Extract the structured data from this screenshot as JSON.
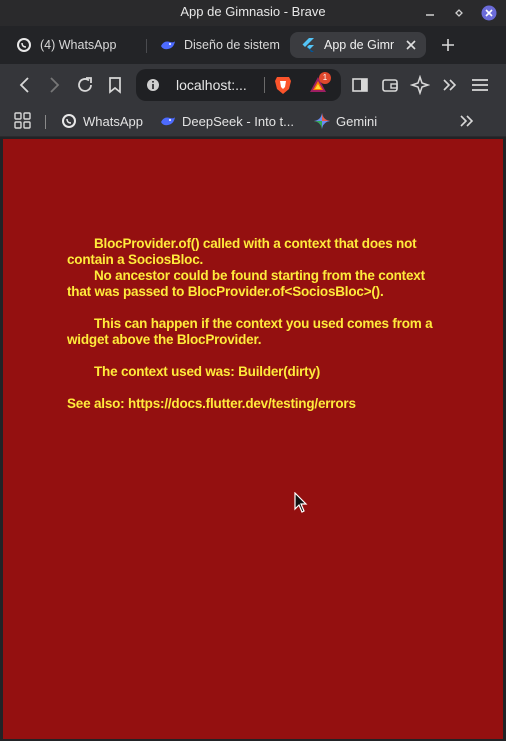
{
  "window": {
    "title": "App de Gimnasio - Brave"
  },
  "tabs": [
    {
      "label": "(4) WhatsApp",
      "icon": "whatsapp-icon",
      "active": false
    },
    {
      "label": "Diseño de sistem",
      "icon": "deepseek-icon",
      "active": false
    },
    {
      "label": "App de Gimna",
      "icon": "flutter-icon",
      "active": true
    }
  ],
  "toolbar": {
    "address": "localhost:...",
    "rewards_badge": "1"
  },
  "bookmarks": [
    {
      "label": "WhatsApp",
      "icon": "whatsapp-icon"
    },
    {
      "label": "DeepSeek - Into t...",
      "icon": "deepseek-icon"
    },
    {
      "label": "Gemini",
      "icon": "gemini-icon"
    }
  ],
  "error": {
    "line1": "BlocProvider.of() called with a context that does not contain a SociosBloc.",
    "line2": "No ancestor could be found starting from the context that was passed to BlocProvider.of<SociosBloc>().",
    "line3": "This can happen if the context you used comes from a widget above the BlocProvider.",
    "line4": "The context used was: Builder(dirty)",
    "line5": "See also: https://docs.flutter.dev/testing/errors"
  },
  "colors": {
    "page_background": "#941010",
    "error_text": "#ffeb3b"
  }
}
